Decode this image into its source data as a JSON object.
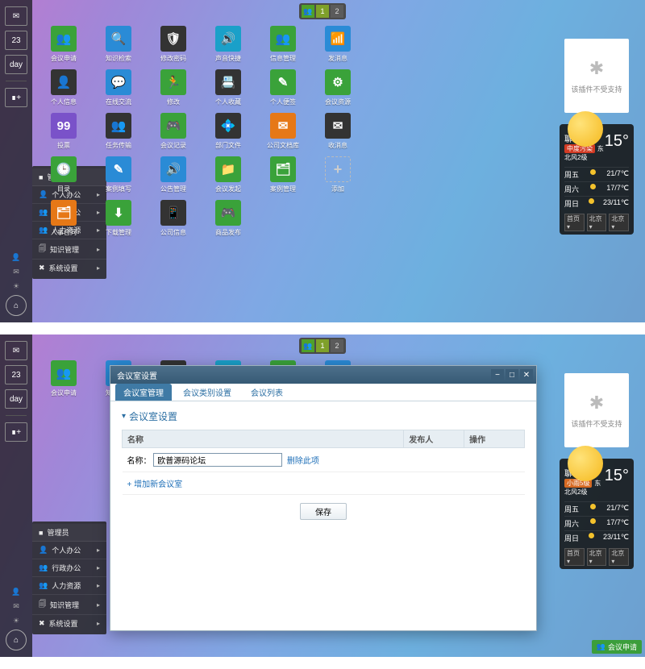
{
  "pager": {
    "icon": "👥",
    "p1": "1",
    "p2": "2"
  },
  "leftbar": {
    "items": [
      {
        "name": "mail-icon",
        "glyph": "✉"
      },
      {
        "name": "calendar-icon",
        "glyph": "23"
      },
      {
        "name": "day-icon",
        "glyph": "day"
      },
      {
        "name": "add-tile-icon",
        "glyph": "∎+"
      }
    ],
    "status": [
      {
        "name": "user-icon",
        "glyph": "👤"
      },
      {
        "name": "msg-icon",
        "glyph": "✉"
      },
      {
        "name": "sun-icon",
        "glyph": "☀"
      }
    ],
    "home": "⌂"
  },
  "menu": {
    "head": {
      "label": "管理员",
      "icon": "■"
    },
    "items": [
      {
        "label": "个人办公",
        "icon": "👤"
      },
      {
        "label": "行政办公",
        "icon": "👥"
      },
      {
        "label": "人力资源",
        "icon": "👥"
      },
      {
        "label": "知识管理",
        "icon": "🗐"
      },
      {
        "label": "系统设置",
        "icon": "✖"
      }
    ]
  },
  "grid": [
    [
      {
        "label": "会议申请",
        "color": "#3aa23a",
        "glyph": "👥"
      },
      {
        "label": "知识检索",
        "color": "#2a8bd6",
        "glyph": "🔍"
      },
      {
        "label": "修改密码",
        "color": "#333",
        "glyph": "🛡"
      },
      {
        "label": "声音快捷",
        "color": "#1aa0c9",
        "glyph": "🔊"
      },
      {
        "label": "信息管理",
        "color": "#3aa23a",
        "glyph": "👥"
      },
      {
        "label": "发消息",
        "color": "#2a8bd6",
        "glyph": "📶"
      }
    ],
    [
      {
        "label": "个人信息",
        "color": "#333",
        "glyph": "👤"
      },
      {
        "label": "在线交流",
        "color": "#2a8bd6",
        "glyph": "💬"
      },
      {
        "label": "修改",
        "color": "#3aa23a",
        "glyph": "🏃"
      },
      {
        "label": "个人收藏",
        "color": "#333",
        "glyph": "📇"
      },
      {
        "label": "个人便签",
        "color": "#3aa23a",
        "glyph": "✎"
      },
      {
        "label": "会议资源",
        "color": "#3aa23a",
        "glyph": "⚙"
      }
    ],
    [
      {
        "label": "投票",
        "color": "#7a52c9",
        "glyph": "99"
      },
      {
        "label": "任务传输",
        "color": "#333",
        "glyph": "👥"
      },
      {
        "label": "会议记录",
        "color": "#3aa23a",
        "glyph": "🎮"
      },
      {
        "label": "部门文件",
        "color": "#333",
        "glyph": "💠"
      },
      {
        "label": "公司文档库",
        "color": "#e67817",
        "glyph": "✉"
      },
      {
        "label": "收消息",
        "color": "#333",
        "glyph": "✉"
      }
    ],
    [
      {
        "label": "目录",
        "color": "#3aa23a",
        "glyph": "🕒"
      },
      {
        "label": "案例填写",
        "color": "#2a8bd6",
        "glyph": "✎"
      },
      {
        "label": "公告管理",
        "color": "#2a8bd6",
        "glyph": "🔊"
      },
      {
        "label": "会议发起",
        "color": "#3aa23a",
        "glyph": "📁"
      },
      {
        "label": "案例管理",
        "color": "#3aa23a",
        "glyph": "🗂"
      },
      {
        "label": "添加",
        "color": "add",
        "glyph": "+"
      }
    ],
    [
      {
        "label": "人事合同",
        "color": "#e67817",
        "glyph": "🗂"
      },
      {
        "label": "下载管理",
        "color": "#3aa23a",
        "glyph": "⬇"
      },
      {
        "label": "公司信息",
        "color": "#333",
        "glyph": "📱"
      },
      {
        "label": "商品发布",
        "color": "#3aa23a",
        "glyph": "🎮"
      }
    ]
  ],
  "plugin": {
    "text": "该插件不受支持",
    "glyph": "✱"
  },
  "weather": {
    "city": "聊城",
    "cond": "晴",
    "temp": "15°",
    "badge1": "中度污染",
    "badge2": "东北风2级",
    "forecast": [
      {
        "day": "周五",
        "range": "21/7℃"
      },
      {
        "day": "周六",
        "range": "17/7℃"
      },
      {
        "day": "周日",
        "range": "23/11℃"
      }
    ],
    "sel1": "首页",
    "sel2": "北京",
    "sel3": "北京"
  },
  "weather2_badge1": "小雨5级",
  "corner": {
    "glyph": "👥",
    "label": "会议申请"
  },
  "modal": {
    "title": "会议室设置",
    "tabs": [
      {
        "label": "会议室管理",
        "active": true
      },
      {
        "label": "会议类别设置",
        "active": false
      },
      {
        "label": "会议列表",
        "active": false
      }
    ],
    "subheader": "会议室设置",
    "columns": {
      "c1": "名称",
      "c2": "发布人",
      "c3": "操作"
    },
    "row": {
      "label": "名称：",
      "value": "欧普源码论坛",
      "del": "删除此项"
    },
    "addlink": "+ 增加新会议室",
    "save": "保存"
  }
}
